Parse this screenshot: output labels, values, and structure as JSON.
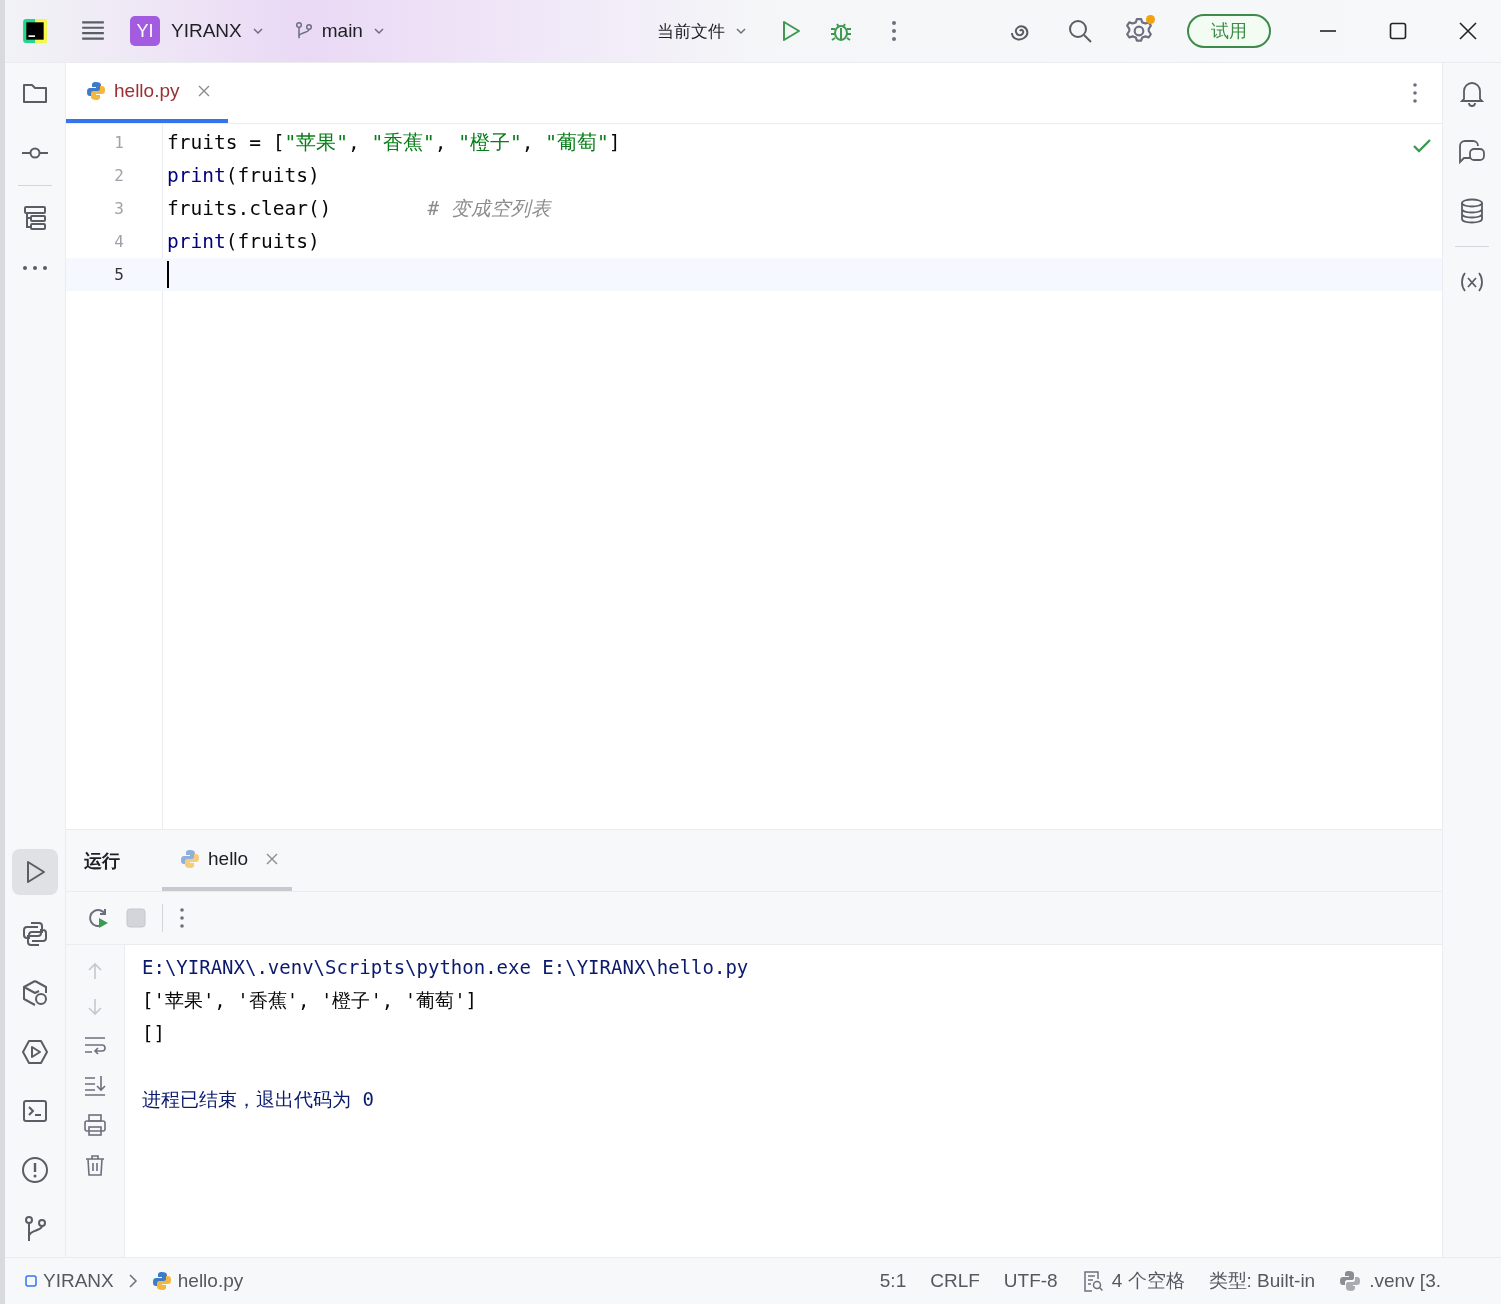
{
  "title_bar": {
    "project_badge": "YI",
    "project": "YIRANX",
    "branch": "main",
    "run_config": "当前文件",
    "trial_button": "试用",
    "settings_update": true
  },
  "editor": {
    "tabs": [
      {
        "label": "hello.py",
        "selected": true
      }
    ],
    "lines": [
      {
        "number": "1",
        "selected": false,
        "tokens": [
          {
            "kind": "plain",
            "text": "fruits = ["
          },
          {
            "kind": "string",
            "text": "\"苹果\""
          },
          {
            "kind": "plain",
            "text": ", "
          },
          {
            "kind": "string",
            "text": "\"香蕉\""
          },
          {
            "kind": "plain",
            "text": ", "
          },
          {
            "kind": "string",
            "text": "\"橙子\""
          },
          {
            "kind": "plain",
            "text": ", "
          },
          {
            "kind": "string",
            "text": "\"葡萄\""
          },
          {
            "kind": "plain",
            "text": "]"
          }
        ]
      },
      {
        "number": "2",
        "selected": false,
        "tokens": [
          {
            "kind": "builtin",
            "text": "print"
          },
          {
            "kind": "plain",
            "text": "(fruits)"
          }
        ]
      },
      {
        "number": "3",
        "selected": false,
        "tokens": [
          {
            "kind": "plain",
            "text": "fruits.clear()"
          },
          {
            "kind": "comment",
            "text": "# 变成空列表"
          }
        ]
      },
      {
        "number": "4",
        "selected": false,
        "tokens": [
          {
            "kind": "builtin",
            "text": "print"
          },
          {
            "kind": "plain",
            "text": "(fruits)"
          }
        ]
      },
      {
        "number": "5",
        "selected": true
      }
    ]
  },
  "run_panel": {
    "title": "运行",
    "tabs": [
      {
        "label": "hello",
        "selected": true
      }
    ],
    "output": [
      {
        "kind": "command",
        "text": "E:\\YIRANX\\.venv\\Scripts\\python.exe E:\\YIRANX\\hello.py"
      },
      {
        "kind": "stdout",
        "text": "['苹果', '香蕉', '橙子', '葡萄']"
      },
      {
        "kind": "stdout",
        "text": "[]"
      },
      {
        "kind": "exit",
        "text": "进程已结束，退出代码为 0"
      }
    ]
  },
  "status_bar": {
    "breadcrumbs": [
      {
        "kind": "project",
        "text": "YIRANX"
      },
      {
        "kind": "file",
        "text": "hello.py"
      }
    ],
    "items": [
      {
        "kind": "text",
        "text": "5:1"
      },
      {
        "kind": "text",
        "text": "CRLF"
      },
      {
        "kind": "text",
        "text": "UTF-8"
      },
      {
        "kind": "indent",
        "text": "4 个空格"
      },
      {
        "kind": "text",
        "text": "类型: Built-in"
      },
      {
        "kind": "interpreter",
        "text": ".venv [3."
      }
    ]
  }
}
